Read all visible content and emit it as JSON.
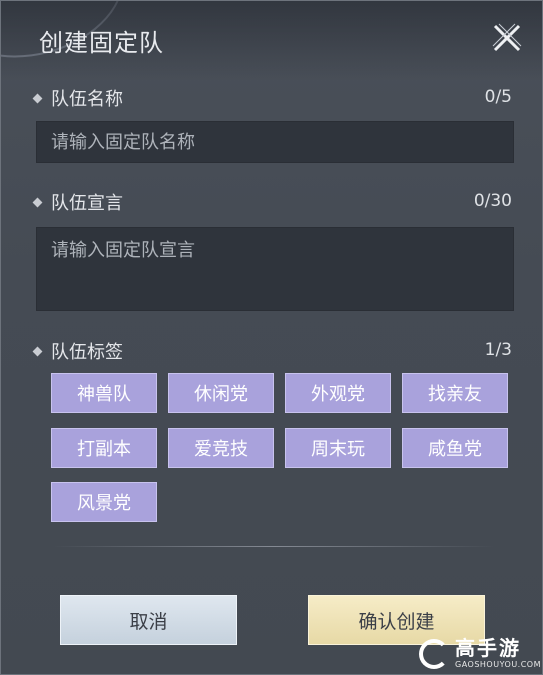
{
  "dialog": {
    "title": "创建固定队"
  },
  "name_section": {
    "label": "队伍名称",
    "count": "0/5",
    "placeholder": "请输入固定队名称"
  },
  "declaration_section": {
    "label": "队伍宣言",
    "count": "0/30",
    "placeholder": "请输入固定队宣言"
  },
  "tags_section": {
    "label": "队伍标签",
    "count": "1/3",
    "tags": [
      "神兽队",
      "休闲党",
      "外观党",
      "找亲友",
      "打副本",
      "爱竞技",
      "周末玩",
      "咸鱼党",
      "风景党"
    ]
  },
  "buttons": {
    "cancel": "取消",
    "confirm": "确认创建"
  },
  "watermark": {
    "cn": "高手游",
    "en": "GAOSHOUYOU.COM"
  },
  "colors": {
    "tag_bg": "#a9a2dc",
    "cancel_bg": "#d3dde7",
    "confirm_bg": "#eee2b6",
    "input_bg": "#2f343c"
  }
}
